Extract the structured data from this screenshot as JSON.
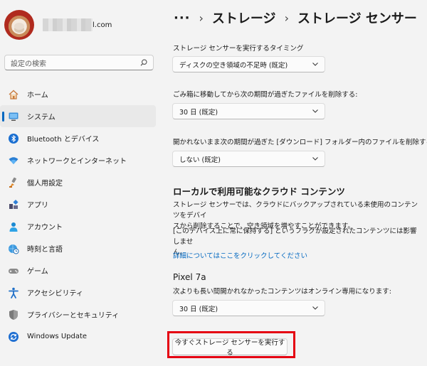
{
  "profile": {
    "email_suffix": "l.com"
  },
  "search": {
    "placeholder": "設定の検索"
  },
  "sidebar": {
    "items": [
      {
        "label": "ホーム",
        "icon": "home-icon"
      },
      {
        "label": "システム",
        "icon": "monitor-icon",
        "selected": true
      },
      {
        "label": "Bluetooth とデバイス",
        "icon": "bluetooth-icon"
      },
      {
        "label": "ネットワークとインターネット",
        "icon": "wifi-icon"
      },
      {
        "label": "個人用設定",
        "icon": "paintbrush-icon"
      },
      {
        "label": "アプリ",
        "icon": "apps-icon"
      },
      {
        "label": "アカウント",
        "icon": "person-icon"
      },
      {
        "label": "時刻と言語",
        "icon": "globe-clock-icon"
      },
      {
        "label": "ゲーム",
        "icon": "gamepad-icon"
      },
      {
        "label": "アクセシビリティ",
        "icon": "accessibility-icon"
      },
      {
        "label": "プライバシーとセキュリティ",
        "icon": "shield-icon"
      },
      {
        "label": "Windows Update",
        "icon": "update-icon"
      }
    ]
  },
  "breadcrumb": {
    "dots": "···",
    "sep": "›",
    "parent": "ストレージ",
    "current": "ストレージ センサー"
  },
  "settings": {
    "timing_label": "ストレージ センサーを実行するタイミング",
    "timing_value": "ディスクの空き領域の不足時 (既定)",
    "recycle_label": "ごみ箱に移動してから次の期間が過ぎたファイルを削除する:",
    "recycle_value": "30 日 (既定)",
    "downloads_label": "開かれないまま次の期間が過ぎた [ダウンロード] フォルダー内のファイルを削除する:",
    "downloads_value": "しない (既定)"
  },
  "cloud": {
    "title": "ローカルで利用可能なクラウド コンテンツ",
    "desc_line1": "ストレージ センサーでは、クラウドにバックアップされている未使用のコンテンツをデバイ",
    "desc_line2": "スから削除することで、空き領域を増やすことができます。",
    "note_line1": "[このデバイス上に常に保持する] というフラグが設定されたコンテンツには影響しませ",
    "note_line2": "ん。",
    "link": "詳細についてはここをクリックしてください"
  },
  "account": {
    "name": "Pixel 7a",
    "online_label": "次よりも長い間開かれなかったコンテンツはオンライン専用になります:",
    "online_value": "30 日 (既定)"
  },
  "run_button": "今すぐストレージ センサーを実行する",
  "colors": {
    "accent": "#0067c0",
    "highlight": "#e50012"
  }
}
